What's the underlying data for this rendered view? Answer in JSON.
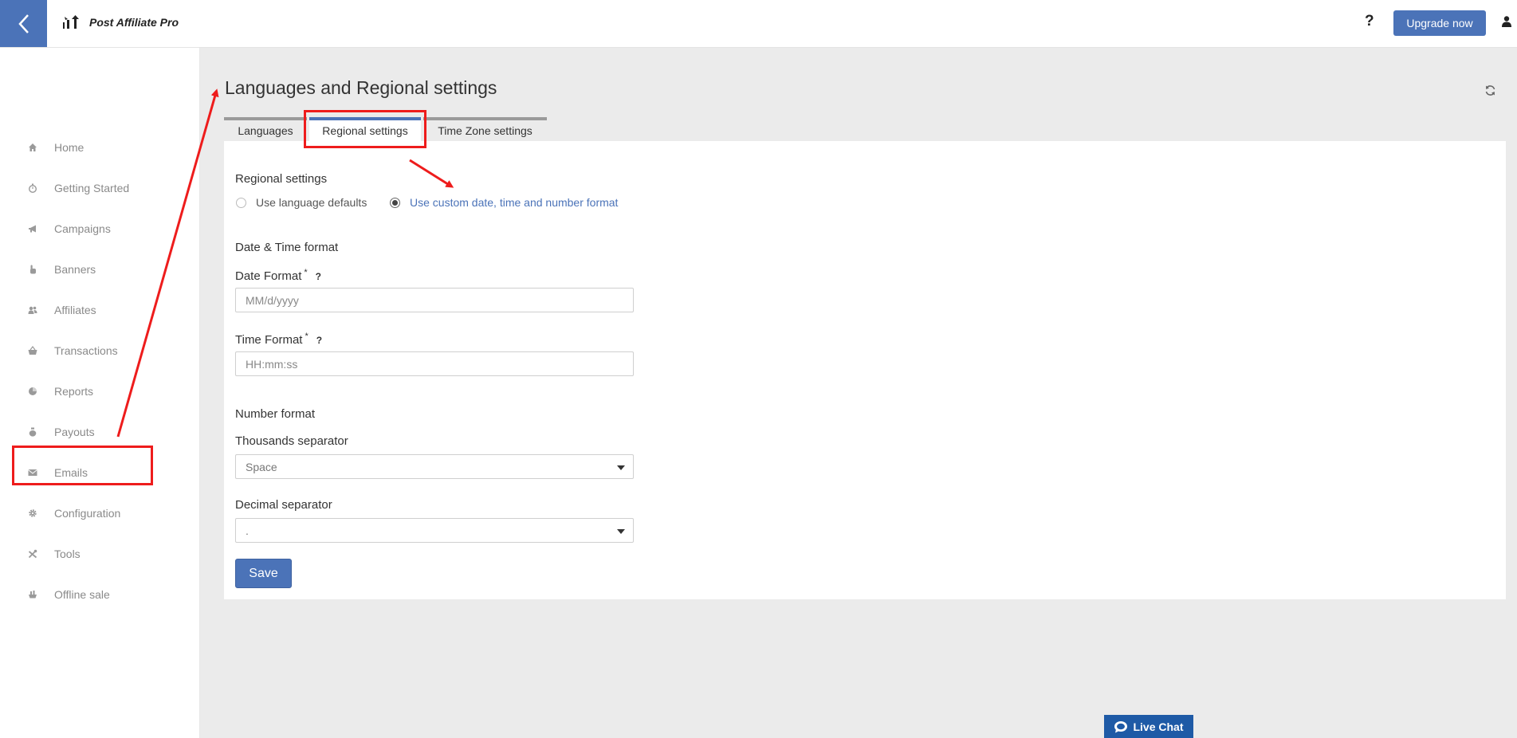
{
  "header": {
    "app_name": "Post Affiliate Pro",
    "help_label": "?",
    "upgrade_label": "Upgrade now"
  },
  "sidebar": {
    "items": [
      {
        "label": "Home",
        "icon": "home-icon"
      },
      {
        "label": "Getting Started",
        "icon": "stopwatch-icon"
      },
      {
        "label": "Campaigns",
        "icon": "megaphone-icon"
      },
      {
        "label": "Banners",
        "icon": "hand-pointer-icon"
      },
      {
        "label": "Affiliates",
        "icon": "users-icon"
      },
      {
        "label": "Transactions",
        "icon": "basket-icon"
      },
      {
        "label": "Reports",
        "icon": "pie-chart-icon"
      },
      {
        "label": "Payouts",
        "icon": "money-bag-icon"
      },
      {
        "label": "Emails",
        "icon": "envelope-icon"
      },
      {
        "label": "Configuration",
        "icon": "gear-icon"
      },
      {
        "label": "Tools",
        "icon": "tools-icon"
      },
      {
        "label": "Offline sale",
        "icon": "offline-sale-icon"
      }
    ]
  },
  "main": {
    "title": "Languages and Regional settings",
    "tabs": [
      {
        "label": "Languages"
      },
      {
        "label": "Regional settings"
      },
      {
        "label": "Time Zone settings"
      }
    ],
    "regional": {
      "heading": "Regional settings",
      "option_defaults": "Use language defaults",
      "option_custom": "Use custom date, time and number format"
    },
    "datetime": {
      "heading": "Date & Time format",
      "date_label": "Date Format",
      "date_value": "MM/d/yyyy",
      "time_label": "Time Format",
      "time_value": "HH:mm:ss",
      "required_mark": "*",
      "help_mark": "?"
    },
    "number": {
      "heading": "Number format",
      "thousands_label": "Thousands separator",
      "thousands_value": "Space",
      "decimal_label": "Decimal separator",
      "decimal_value": "."
    },
    "save_label": "Save"
  },
  "live_chat": {
    "label": "Live Chat"
  },
  "colors": {
    "accent": "#4b73b8",
    "annotation": "#ee1c1c",
    "link": "#4b73b8",
    "live_chat": "#1e5aa6"
  }
}
